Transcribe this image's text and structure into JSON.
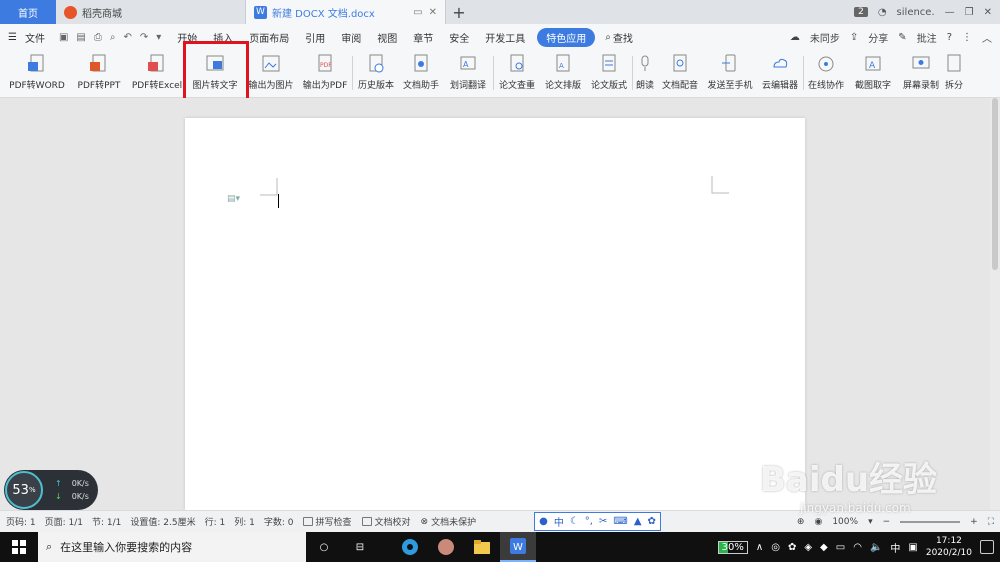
{
  "tabs": {
    "home": "首页",
    "store": "稻壳商城",
    "doc": "新建 DOCX 文档.docx",
    "count": "2",
    "user": "silence."
  },
  "menu": {
    "file": "文件",
    "items": [
      "开始",
      "插入",
      "页面布局",
      "引用",
      "审阅",
      "视图",
      "章节",
      "安全",
      "开发工具"
    ],
    "special": "特色应用",
    "search": "查找",
    "sync": "未同步",
    "share": "分享",
    "comment": "批注"
  },
  "ribbon": {
    "items": [
      "PDF转WORD",
      "PDF转PPT",
      "PDF转Excel",
      "图片转文字",
      "输出为图片",
      "输出为PDF",
      "历史版本",
      "文档助手",
      "划词翻译",
      "论文查重",
      "论文排版",
      "论文版式",
      "朗读",
      "文档配音",
      "发送至手机",
      "云编辑器",
      "在线协作",
      "截图取字",
      "屏幕录制",
      "拆分"
    ]
  },
  "speed": {
    "percent": "53",
    "unit": "%",
    "up": "0K/s",
    "down": "0K/s"
  },
  "status": {
    "page_code": "页码: 1",
    "pages": "页面: 1/1",
    "section": "节: 1/1",
    "setting": "设置值: 2.5厘米",
    "row": "行: 1",
    "col": "列: 1",
    "words": "字数: 0",
    "spell": "拼写检查",
    "proof": "文档校对",
    "protect": "文档未保护",
    "zoom": "100%",
    "ime_lang": "中"
  },
  "taskbar": {
    "search_placeholder": "在这里输入你要搜索的内容",
    "battery": "30%",
    "ime": "中",
    "time": "17:12",
    "date": "2020/2/10"
  },
  "watermark": {
    "brand": "Baidu经验",
    "url": "jingyan.baidu.com"
  },
  "colors": {
    "accent": "#3d7be0",
    "highlight": "#e0141e"
  }
}
